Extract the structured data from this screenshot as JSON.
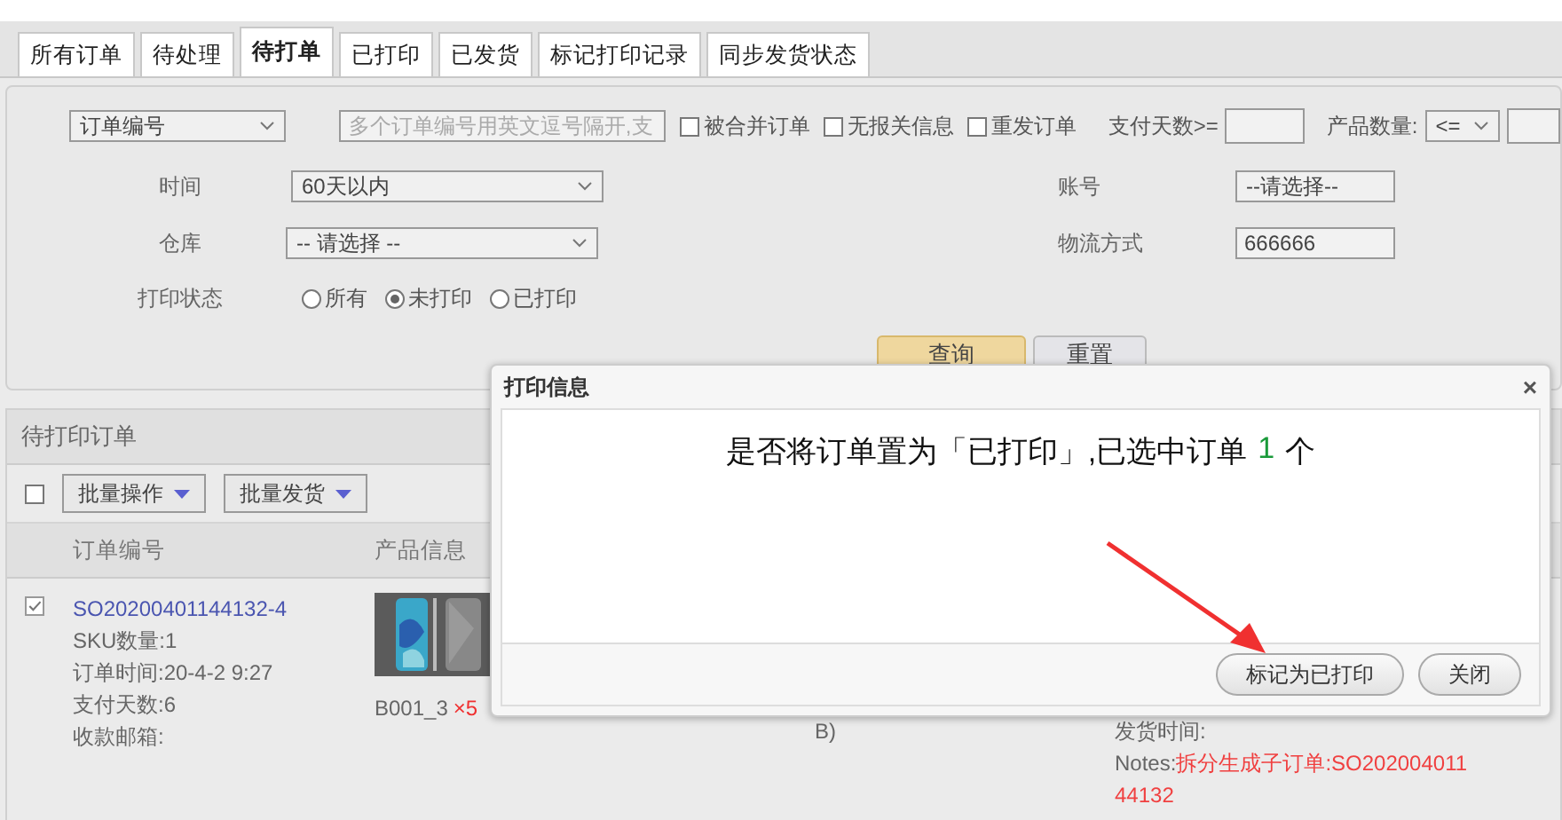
{
  "tabs": [
    {
      "label": "所有订单",
      "selected": false
    },
    {
      "label": "待处理",
      "selected": false
    },
    {
      "label": "待打单",
      "selected": true
    },
    {
      "label": "已打印",
      "selected": false
    },
    {
      "label": "已发货",
      "selected": false
    },
    {
      "label": "标记打印记录",
      "selected": false
    },
    {
      "label": "同步发货状态",
      "selected": false
    }
  ],
  "filters": {
    "search_field": {
      "value": "订单编号"
    },
    "search_input": {
      "placeholder": "多个订单编号用英文逗号隔开,支"
    },
    "checkboxes": [
      {
        "label": "被合并订单",
        "checked": false
      },
      {
        "label": "无报关信息",
        "checked": false
      },
      {
        "label": "重发订单",
        "checked": false
      }
    ],
    "pay_days": {
      "label": "支付天数>="
    },
    "product_count": {
      "label": "产品数量:",
      "operator": "<="
    },
    "time": {
      "label": "时间",
      "value": "60天以内"
    },
    "account": {
      "label": "账号",
      "value": "--请选择--"
    },
    "warehouse": {
      "label": "仓库",
      "value": "-- 请选择 --"
    },
    "logistics": {
      "label": "物流方式",
      "value": "666666"
    },
    "print_status": {
      "label": "打印状态",
      "options": [
        {
          "label": "所有",
          "selected": false
        },
        {
          "label": "未打印",
          "selected": true
        },
        {
          "label": "已打印",
          "selected": false
        }
      ]
    },
    "buttons": [
      {
        "label": "查询",
        "kind": "primary"
      },
      {
        "label": "重置",
        "kind": "plain"
      }
    ]
  },
  "orders": {
    "title": "待打印订单",
    "select_all": {
      "checked": false
    },
    "actions": [
      "批量操作",
      "批量发货"
    ],
    "columns": [
      "订单编号",
      "产品信息"
    ],
    "rows": [
      {
        "selected": true,
        "order_no": "SO20200401144132-4",
        "details": [
          "SKU数量:1",
          "订单时间:20-4-2 9:27",
          "支付天数:6",
          "收款邮箱:"
        ],
        "product": {
          "kind": "picture",
          "sku": "B001_3",
          "qty": "×5"
        },
        "column_3": [
          "B)"
        ],
        "column_4": {
          "lines": [
            "发货时间:"
          ],
          "notes_label": "Notes:",
          "notes": "拆分生成子订单:SO20200401144132"
        }
      }
    ]
  },
  "dialog": {
    "title": "打印信息",
    "close": "×",
    "message_before": "是否将订单置为「已打印」,已选中订单",
    "count": "1",
    "message_after": "个",
    "buttons": [
      "标记为已打印",
      "关闭"
    ]
  }
}
